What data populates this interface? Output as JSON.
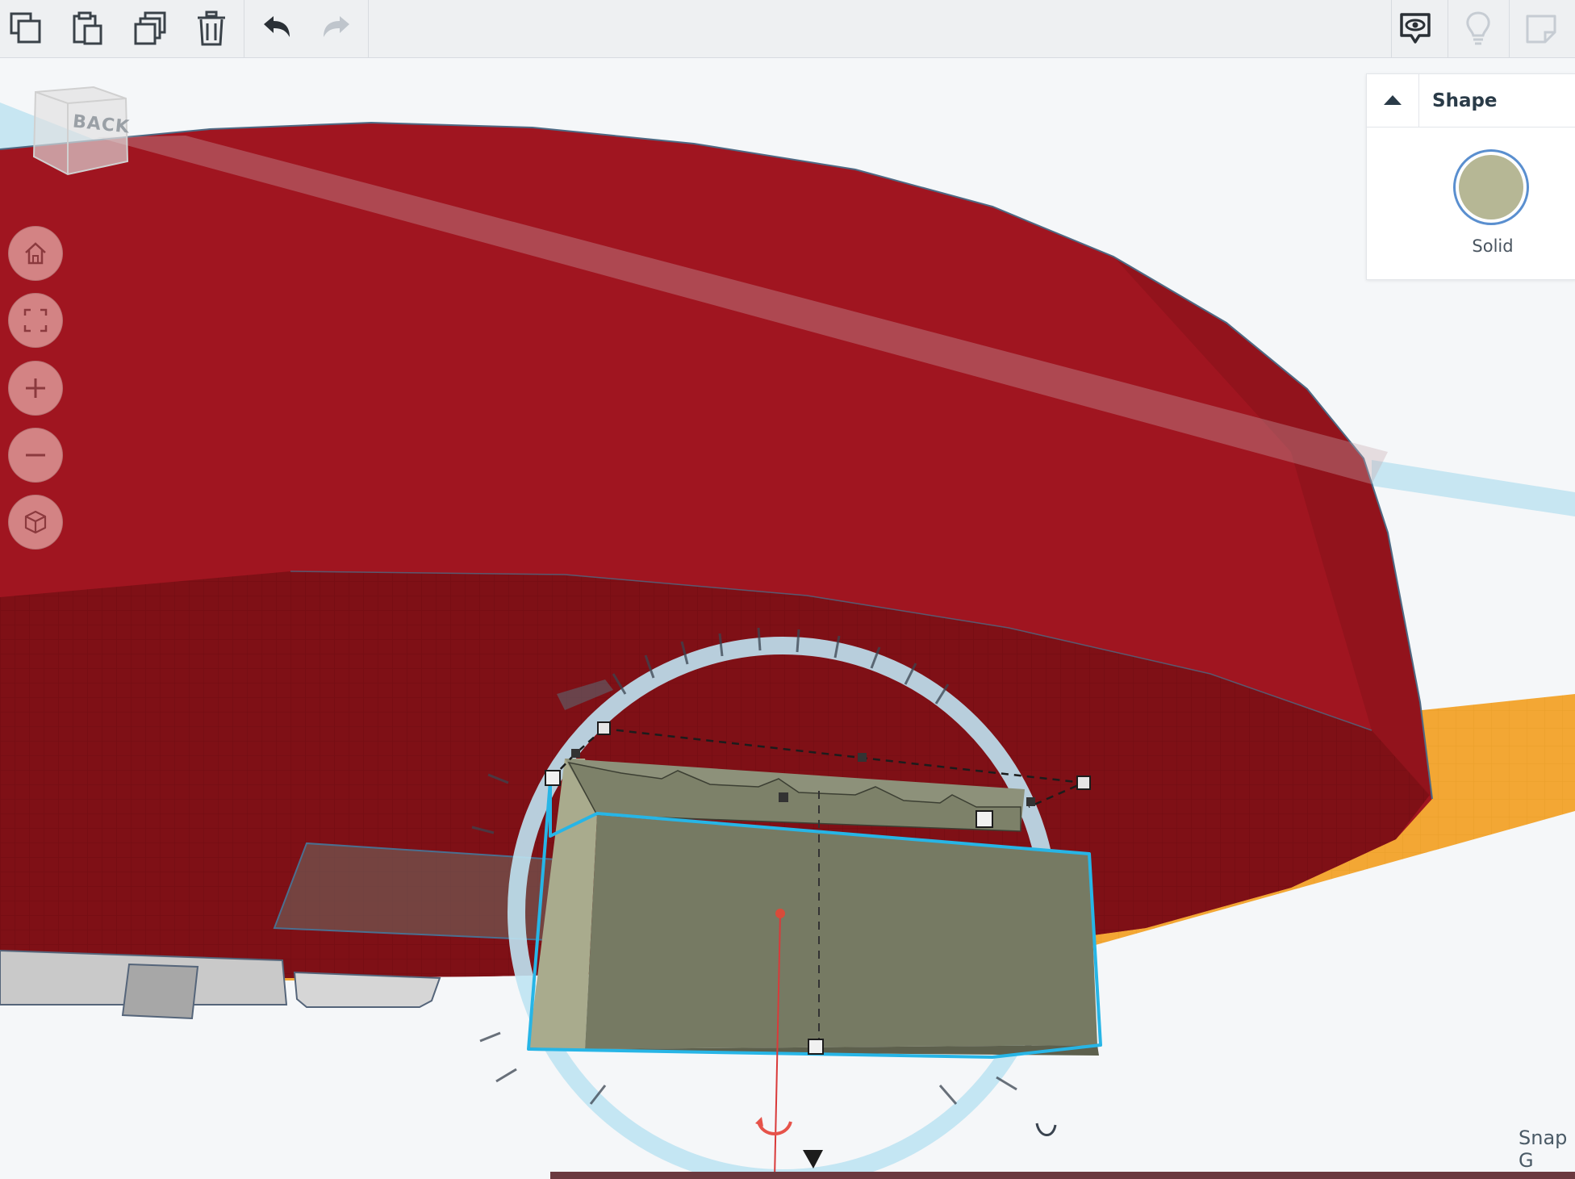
{
  "toolbar": {
    "tools": [
      {
        "name": "copy",
        "icon": "copy-icon"
      },
      {
        "name": "paste",
        "icon": "paste-icon"
      },
      {
        "name": "duplicate",
        "icon": "duplicate-icon"
      },
      {
        "name": "delete",
        "icon": "trash-icon"
      },
      {
        "name": "undo",
        "icon": "undo-icon"
      },
      {
        "name": "redo",
        "icon": "redo-icon"
      }
    ],
    "right_tools": [
      {
        "name": "show-all",
        "icon": "eye-bubble-icon"
      },
      {
        "name": "hints",
        "icon": "lightbulb-icon"
      },
      {
        "name": "notes",
        "icon": "note-icon"
      }
    ]
  },
  "viewcube": {
    "label": "BACK"
  },
  "nav_buttons": [
    {
      "name": "home",
      "icon": "home-icon"
    },
    {
      "name": "fit",
      "icon": "fit-view-icon"
    },
    {
      "name": "zoom-in",
      "icon": "plus-icon"
    },
    {
      "name": "zoom-out",
      "icon": "minus-icon"
    },
    {
      "name": "perspective",
      "icon": "cube-icon"
    }
  ],
  "inspector": {
    "title": "Shape",
    "solid_label": "Solid",
    "solid_color": "#b6b795"
  },
  "status": {
    "snap_label": "Snap G"
  },
  "colors": {
    "red_shape": "#a01520",
    "olive_shape": "#767a63",
    "workplane_orange": "#f3a734",
    "selection_blue": "#27b5e6",
    "toolbar_bg": "#eef0f2"
  }
}
